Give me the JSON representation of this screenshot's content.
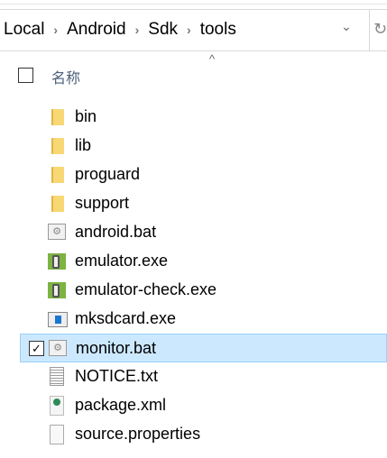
{
  "breadcrumb": [
    "Local",
    "Android",
    "Sdk",
    "tools"
  ],
  "header": {
    "name_column": "名称"
  },
  "files": [
    {
      "name": "bin",
      "type": "folder"
    },
    {
      "name": "lib",
      "type": "folder"
    },
    {
      "name": "proguard",
      "type": "folder"
    },
    {
      "name": "support",
      "type": "folder"
    },
    {
      "name": "android.bat",
      "type": "bat"
    },
    {
      "name": "emulator.exe",
      "type": "emu"
    },
    {
      "name": "emulator-check.exe",
      "type": "emu"
    },
    {
      "name": "mksdcard.exe",
      "type": "mk"
    },
    {
      "name": "monitor.bat",
      "type": "bat",
      "selected": true
    },
    {
      "name": "NOTICE.txt",
      "type": "txt"
    },
    {
      "name": "package.xml",
      "type": "xml"
    },
    {
      "name": "source.properties",
      "type": "blank"
    }
  ],
  "colors": {
    "selection": "#cce8ff",
    "selection_border": "#99d1ff"
  }
}
